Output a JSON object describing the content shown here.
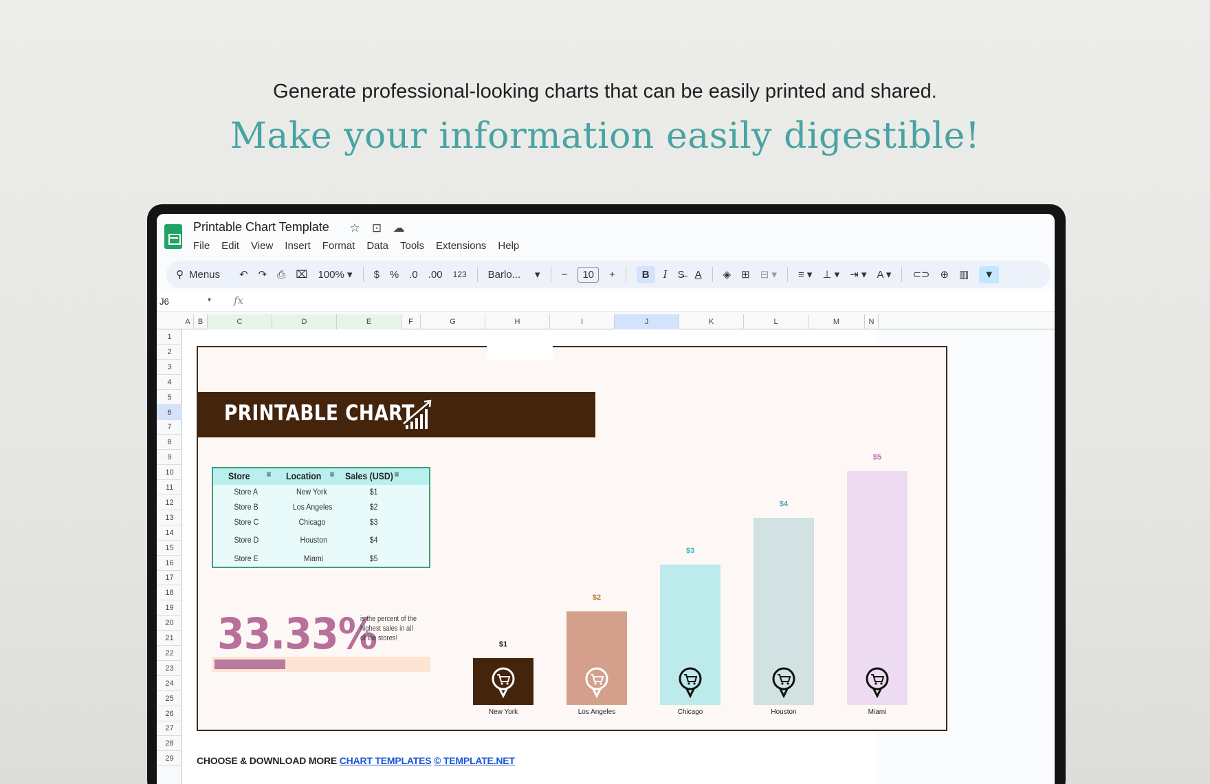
{
  "hero": {
    "tagline": "Generate professional-looking charts that can be easily printed and shared.",
    "headline": "Make your information easily digestible!"
  },
  "app": {
    "title": "Printable Chart Template",
    "title_icons": [
      "star-icon",
      "move-folder-icon",
      "cloud-status-icon"
    ],
    "menu": [
      "File",
      "Edit",
      "View",
      "Insert",
      "Format",
      "Data",
      "Tools",
      "Extensions",
      "Help"
    ]
  },
  "toolbar": {
    "search_label": "Menus",
    "zoom": "100%",
    "currency": "$",
    "percent": "%",
    "decrease_decimal": ".0",
    "increase_decimal": ".00",
    "number_format": "123",
    "font": "Barlo...",
    "font_size": "10",
    "bold": "B",
    "italic": "I",
    "text_color": "A"
  },
  "formula_bar": {
    "cell_ref": "J6",
    "fx": "fx"
  },
  "columns": [
    "A",
    "B",
    "C",
    "D",
    "E",
    "F",
    "G",
    "H",
    "I",
    "J",
    "K",
    "L",
    "M",
    "N"
  ],
  "selected_column": "J",
  "rows": [
    "1",
    "2",
    "3",
    "4",
    "5",
    "6",
    "7",
    "8",
    "9",
    "10",
    "11",
    "12",
    "13",
    "14",
    "15",
    "16",
    "17",
    "18",
    "19",
    "20",
    "21",
    "22",
    "23",
    "24",
    "25",
    "26",
    "27",
    "28",
    "29"
  ],
  "selected_row": "6",
  "sheet": {
    "banner_title": "PRINTABLE CHART",
    "table": {
      "headers": [
        "Store",
        "Location",
        "Sales (USD)"
      ],
      "rows": [
        [
          "Store A",
          "New York",
          "$1"
        ],
        [
          "Store B",
          "Los Angeles",
          "$2"
        ],
        [
          "Store C",
          "Chicago",
          "$3"
        ],
        [
          "Store D",
          "Houston",
          "$4"
        ],
        [
          "Store E",
          "Miami",
          "$5"
        ]
      ]
    },
    "stat": {
      "value": "33.33%",
      "note": "is the percent of the highest sales in all of the stores!",
      "fraction": 0.3333
    }
  },
  "chart_data": {
    "type": "bar",
    "categories": [
      "New York",
      "Los Angeles",
      "Chicago",
      "Houston",
      "Miami"
    ],
    "values": [
      1,
      2,
      3,
      4,
      5
    ],
    "value_labels": [
      "$1",
      "$2",
      "$3",
      "$4",
      "$5"
    ],
    "bar_colors": [
      "#45240c",
      "#d4a08b",
      "#bdeaea",
      "#d2e1e1",
      "#ecdbf1"
    ],
    "label_colors": [
      "#222222",
      "#b97a3f",
      "#3ab2c8",
      "#4aa3b3",
      "#b96fa8"
    ],
    "ylim": [
      0,
      5
    ],
    "title": "",
    "xlabel": "",
    "ylabel": "",
    "icon": "shopping-cart-pin-icon"
  },
  "footer": {
    "prefix": "CHOOSE & DOWNLOAD MORE",
    "link1": "CHART TEMPLATES",
    "link2": "© TEMPLATE.NET"
  },
  "colors": {
    "accent": "#4aa3a3",
    "banner": "#45240c",
    "stat": "#b76f9c",
    "table_border": "#3f9e77"
  }
}
